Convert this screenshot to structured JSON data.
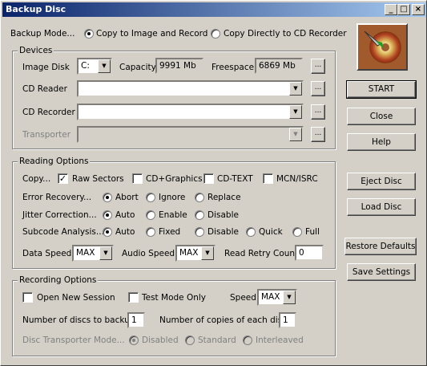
{
  "window": {
    "title": "Backup Disc",
    "min": "_",
    "max": "□",
    "close": "×"
  },
  "mode": {
    "label": "Backup Mode...",
    "opt1": "Copy to Image and Record",
    "opt2": "Copy Directly to CD Recorder"
  },
  "devices": {
    "title": "Devices",
    "image_disk_label": "Image Disk",
    "image_disk_value": "C:",
    "capacity_label": "Capacity",
    "capacity_value": "9991 Mb",
    "freespace_label": "Freespace",
    "freespace_value": "6869 Mb",
    "cd_reader_label": "CD Reader",
    "cd_recorder_label": "CD Recorder",
    "transporter_label": "Transporter",
    "browse": "..."
  },
  "reading": {
    "title": "Reading Options",
    "copy_label": "Copy...",
    "raw": "Raw Sectors",
    "cdg": "CD+Graphics",
    "cdtext": "CD-TEXT",
    "mcn": "MCN/ISRC",
    "err_label": "Error Recovery...",
    "abort": "Abort",
    "ignore": "Ignore",
    "replace": "Replace",
    "jit_label": "Jitter Correction...",
    "auto": "Auto",
    "enable": "Enable",
    "disable": "Disable",
    "sub_label": "Subcode Analysis...",
    "fixed": "Fixed",
    "quick": "Quick",
    "full": "Full",
    "data_speed_label": "Data Speed",
    "data_speed": "MAX",
    "audio_speed_label": "Audio Speed",
    "audio_speed": "MAX",
    "retry_label": "Read Retry Count",
    "retry_value": "0"
  },
  "recording": {
    "title": "Recording Options",
    "open_session": "Open New Session",
    "test_mode": "Test Mode Only",
    "speed_label": "Speed",
    "speed": "MAX",
    "num_discs_label": "Number of discs to backup",
    "num_discs": "1",
    "num_copies_label": "Number of copies of each disc",
    "num_copies": "1",
    "trans_mode_label": "Disc Transporter Mode...",
    "disabled": "Disabled",
    "standard": "Standard",
    "interleaved": "Interleaved"
  },
  "buttons": {
    "start": "START",
    "close": "Close",
    "help": "Help",
    "eject": "Eject Disc",
    "load": "Load Disc",
    "restore": "Restore Defaults",
    "save": "Save Settings"
  }
}
